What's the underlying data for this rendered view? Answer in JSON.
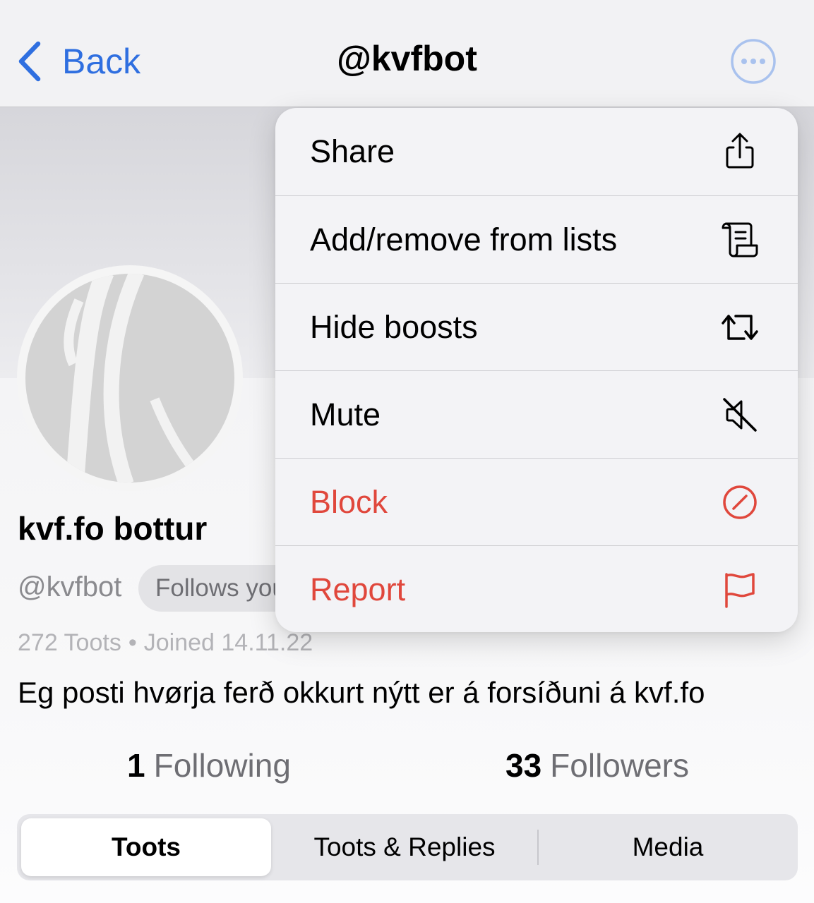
{
  "nav": {
    "back_label": "Back",
    "title": "@kvfbot",
    "accent_color": "#2f6fe0"
  },
  "profile": {
    "display_name": "kvf.fo bottur",
    "handle": "@kvfbot",
    "follows_badge": "Follows you",
    "toots_count": "272 Toots",
    "separator": "•",
    "joined": "Joined 14.11.22",
    "bio": "Eg posti hvørja ferð okkurt nýtt er á forsíðuni á kvf.fo",
    "following_count": "1",
    "following_label": "Following",
    "followers_count": "33",
    "followers_label": "Followers"
  },
  "tabs": [
    {
      "label": "Toots",
      "selected": true
    },
    {
      "label": "Toots & Replies",
      "selected": false
    },
    {
      "label": "Media",
      "selected": false
    }
  ],
  "menu": {
    "items": [
      {
        "label": "Share",
        "icon": "share-icon",
        "destructive": false
      },
      {
        "label": "Add/remove from lists",
        "icon": "list-scroll-icon",
        "destructive": false
      },
      {
        "label": "Hide boosts",
        "icon": "boost-icon",
        "destructive": false
      },
      {
        "label": "Mute",
        "icon": "speaker-slash-icon",
        "destructive": false
      },
      {
        "label": "Block",
        "icon": "block-icon",
        "destructive": true
      },
      {
        "label": "Report",
        "icon": "flag-icon",
        "destructive": true
      }
    ],
    "destructive_color": "#e0473c"
  }
}
